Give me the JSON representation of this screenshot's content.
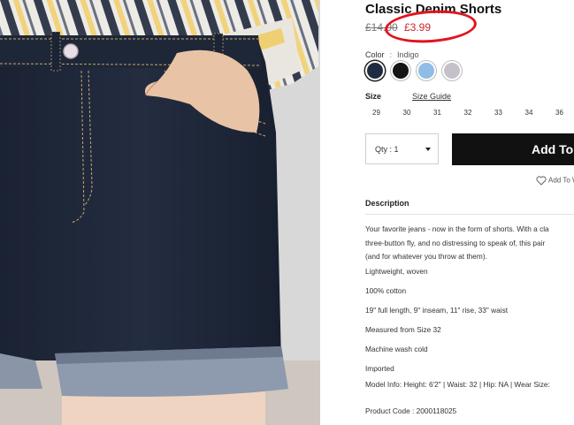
{
  "product": {
    "title": "Classic Denim Shorts",
    "original_price": "£14.90",
    "sale_price": "£3.99",
    "color_label": "Color",
    "color_separator": ":",
    "color_value": "Indigo",
    "swatches": [
      {
        "name": "Indigo",
        "hex": "#1f2b3f"
      },
      {
        "name": "Black",
        "hex": "#151515"
      },
      {
        "name": "Light Blue",
        "hex": "#8fbde6"
      },
      {
        "name": "Grey",
        "hex": "#c4c2c8"
      }
    ],
    "size_label": "Size",
    "size_guide": "Size Guide",
    "sizes": [
      "29",
      "30",
      "31",
      "32",
      "33",
      "34",
      "36"
    ],
    "qty_label": "Qty : 1",
    "add_button": "Add To Bag",
    "wishlist": "Add To Wishlist"
  },
  "description": {
    "heading": "Description",
    "paragraph_lines": [
      "Your favorite jeans - now in the form of shorts. With a cla",
      "three-button fly, and no distressing to speak of, this pair",
      "(and for whatever you throw at them)."
    ],
    "bullets": [
      "Lightweight, woven",
      "100% cotton",
      "19\" full length, 9\" inseam, 11\" rise, 33\" waist",
      "Measured from Size 32",
      "Machine wash cold",
      "Imported",
      "Model Info: Height: 6'2\" | Waist: 32 | Hip: NA | Wear Size:"
    ],
    "product_code": "Product Code : 2000118025"
  },
  "annotation": {
    "color": "#e0141e"
  }
}
